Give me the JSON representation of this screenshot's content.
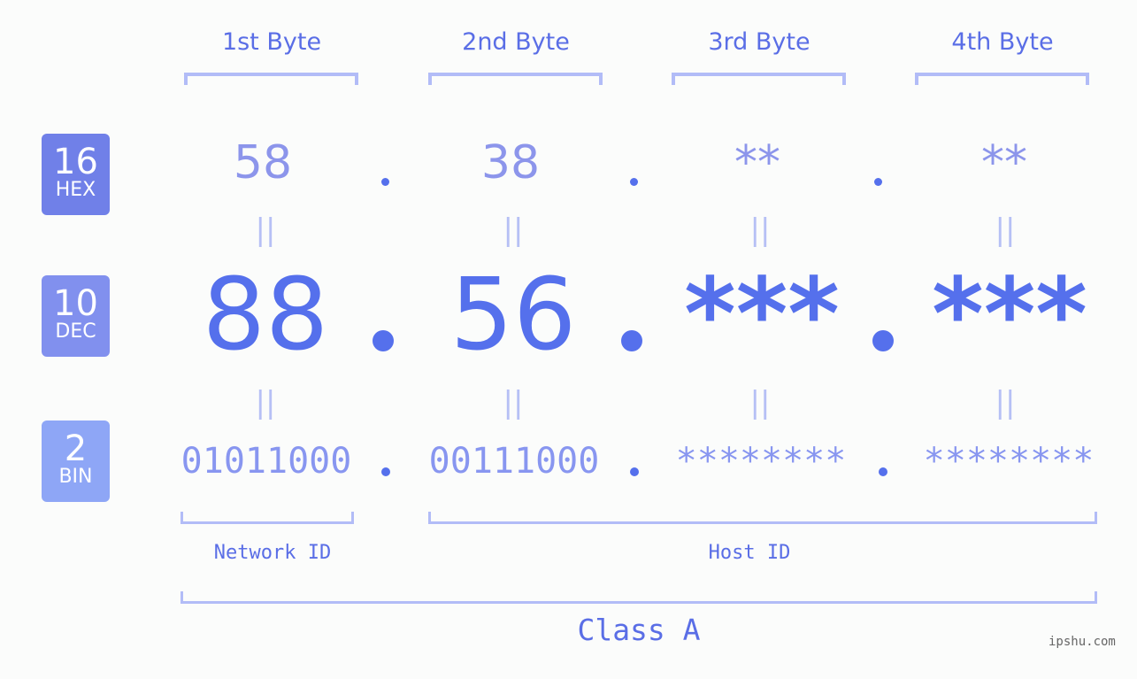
{
  "bytes": {
    "labels": [
      "1st Byte",
      "2nd Byte",
      "3rd Byte",
      "4th Byte"
    ]
  },
  "bases": {
    "hex": {
      "num": "16",
      "label": "HEX",
      "color": "#7080e8"
    },
    "dec": {
      "num": "10",
      "label": "DEC",
      "color": "#8190ee"
    },
    "bin": {
      "num": "2",
      "label": "BIN",
      "color": "#8ea6f6"
    }
  },
  "hex_values": [
    "58",
    "38",
    "**",
    "**"
  ],
  "dec_values": [
    "88",
    "56",
    "***",
    "***"
  ],
  "bin_values": [
    "01011000",
    "00111000",
    "********",
    "********"
  ],
  "equals_symbol": "||",
  "network_id_label": "Network ID",
  "host_id_label": "Host ID",
  "class_label": "Class A",
  "watermark": "ipshu.com",
  "colors": {
    "accent": "#5570ec",
    "bracket": "#b2bcf7",
    "background": "#fbfcfb"
  }
}
